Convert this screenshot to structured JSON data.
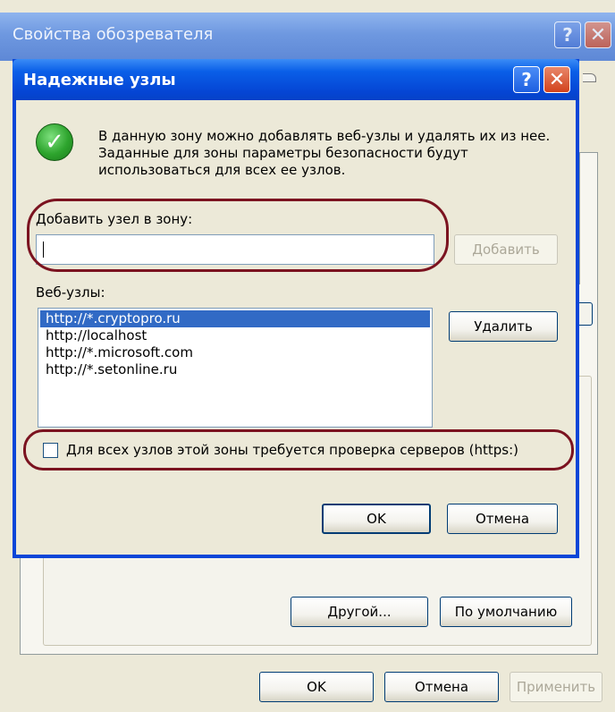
{
  "back_window": {
    "title": "Свойства обозревателя",
    "help_icon_glyph": "?",
    "close_icon_glyph": "✕",
    "other_button": "Другой...",
    "default_button": "По умолчанию",
    "ok_button": "OK",
    "cancel_button": "Отмена",
    "apply_button": "Применить"
  },
  "dialog": {
    "title": "Надежные узлы",
    "help_icon_glyph": "?",
    "close_icon_glyph": "✕",
    "info_text": "В данную зону можно добавлять веб-узлы и удалять их из нее. Заданные для зоны параметры безопасности будут использоваться для всех ее узлов.",
    "add_label": "Добавить узел в зону:",
    "add_input_value": "",
    "add_button": "Добавить",
    "sites_label": "Веб-узлы:",
    "sites": [
      "http://*.cryptopro.ru",
      "http://localhost",
      "http://*.microsoft.com",
      "http://*.setonline.ru"
    ],
    "selected_site_index": 0,
    "remove_button": "Удалить",
    "https_checkbox_label": "Для всех узлов этой зоны требуется проверка серверов (https:)",
    "https_checked": false,
    "ok_button": "OK",
    "cancel_button": "Отмена"
  },
  "icons": {
    "shield": "check-shield-icon",
    "help": "help-icon",
    "close": "close-icon"
  },
  "colors": {
    "title_bar": "#0A5FE8",
    "dialog_face": "#ECE9D8",
    "selection": "#316AC5",
    "annotation": "#7B1320"
  }
}
